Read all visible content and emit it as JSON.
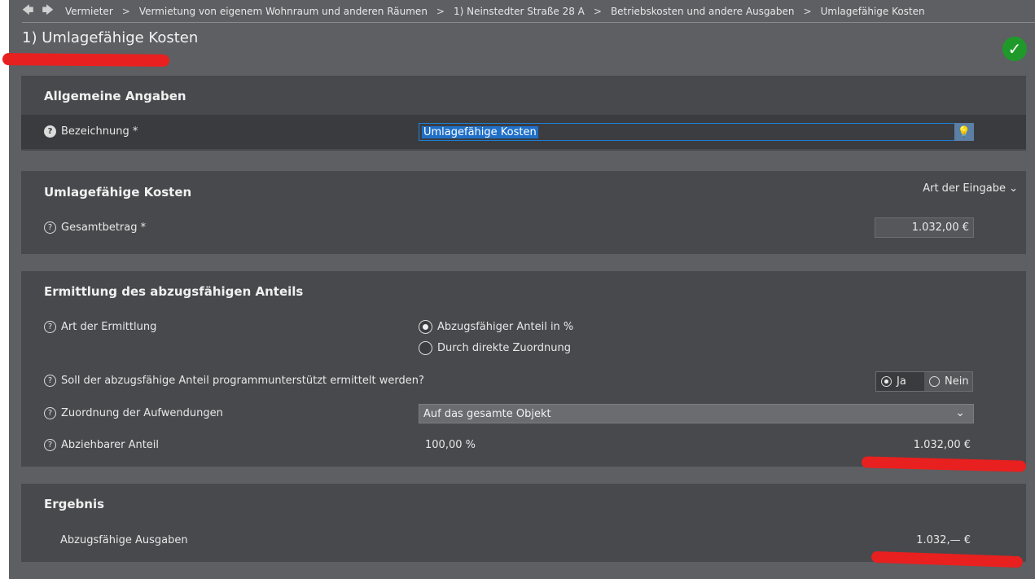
{
  "breadcrumb": {
    "back": "🡄",
    "forward": "🡆",
    "items": [
      "Vermieter",
      "Vermietung von eigenem Wohnraum und anderen Räumen",
      "1) Neinstedter Straße 28 A",
      "Betriebskosten und andere Ausgaben",
      "Umlagefähige Kosten"
    ],
    "separator": ">"
  },
  "page": {
    "title": "1) Umlagefähige Kosten",
    "status_icon": "check-icon"
  },
  "allgemein": {
    "title": "Allgemeine Angaben",
    "bezeichnung_label": "Bezeichnung *",
    "bezeichnung_value": "Umlagefähige Kosten"
  },
  "kosten": {
    "title": "Umlagefähige Kosten",
    "art_label": "Art der Eingabe",
    "gesamt_label": "Gesamtbetrag *",
    "gesamt_value": "1.032,00 €"
  },
  "ermittlung": {
    "title": "Ermittlung des abzugsfähigen Anteils",
    "art_label": "Art der Ermittlung",
    "option1": "Abzugsfähiger Anteil in %",
    "option2": "Durch direkte Zuordnung",
    "selected_option": 1,
    "programm_label": "Soll der abzugsfähige Anteil programmunterstützt ermittelt werden?",
    "ja": "Ja",
    "nein": "Nein",
    "programm_value": "Ja",
    "zuordnung_label": "Zuordnung der Aufwendungen",
    "zuordnung_value": "Auf das gesamte Objekt",
    "anteil_label": "Abziehbarer Anteil",
    "anteil_percent": "100,00 %",
    "anteil_amount": "1.032,00 €"
  },
  "ergebnis": {
    "title": "Ergebnis",
    "ausgaben_label": "Abzugsfähige Ausgaben",
    "ausgaben_value": "1.032,— €"
  },
  "colors": {
    "background": "#5d5f63",
    "panel": "#48494d",
    "accent": "#1e7fd6",
    "success": "#1f9a2a",
    "annotation": "#e8201f"
  }
}
